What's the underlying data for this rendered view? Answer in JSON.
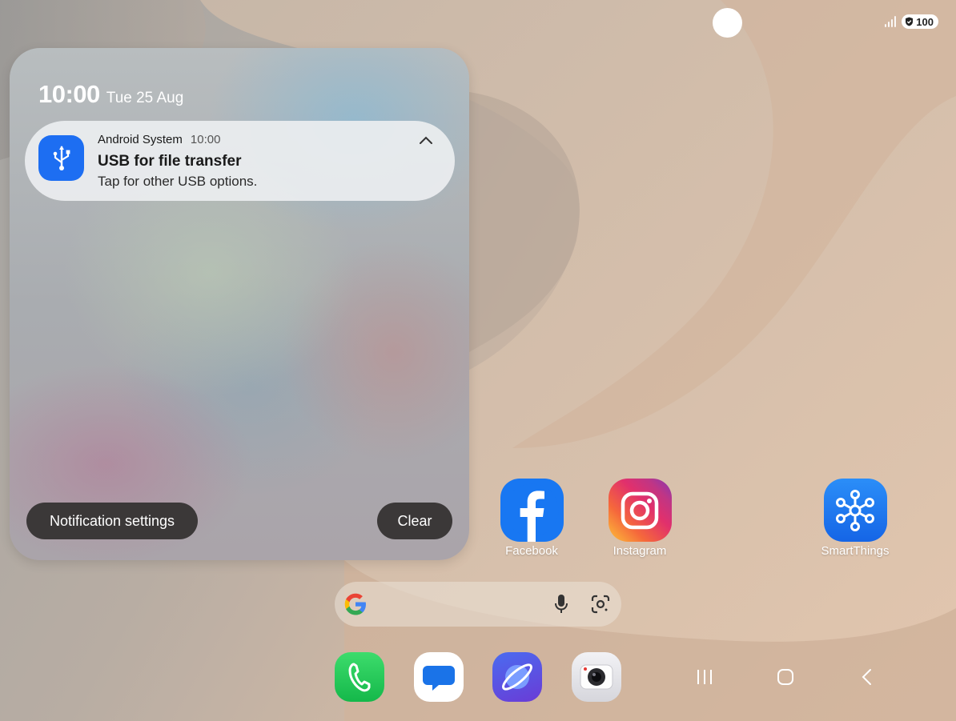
{
  "status_bar": {
    "battery_level": "100"
  },
  "notification_panel": {
    "time": "10:00",
    "date": "Tue 25 Aug",
    "notification": {
      "app_name": "Android System",
      "time": "10:00",
      "title": "USB for file transfer",
      "body": "Tap for other USB options.",
      "icon": "usb-icon"
    },
    "settings_button": "Notification settings",
    "clear_button": "Clear"
  },
  "home_apps": [
    {
      "label": "Facebook",
      "icon": "facebook-icon",
      "color": "#1877f2"
    },
    {
      "label": "Instagram",
      "icon": "instagram-icon",
      "color": "#e1306c"
    },
    {
      "label": "SmartThings",
      "icon": "smartthings-icon",
      "color": "#1e7cf5"
    }
  ],
  "dock": [
    {
      "name": "Phone",
      "icon": "phone-icon",
      "color": "#22c55e"
    },
    {
      "name": "Messages",
      "icon": "messages-icon",
      "color": "#1a73e8"
    },
    {
      "name": "Internet",
      "icon": "browser-icon",
      "color": "#5b4ae0"
    },
    {
      "name": "Camera",
      "icon": "camera-icon",
      "color": "#e8e8ec"
    }
  ],
  "nav_bar": [
    "recents-icon",
    "home-icon",
    "back-icon"
  ]
}
